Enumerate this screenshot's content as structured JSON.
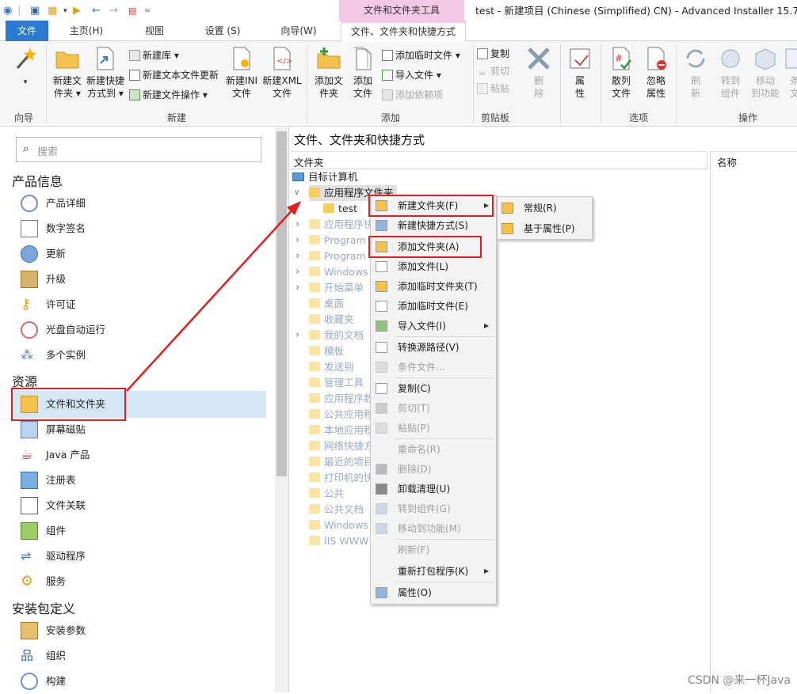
{
  "app": {
    "window_title": "test - 新建项目 (Chinese (Simplified) CN) - Advanced Installer 15.7*",
    "context_tool_tab": "文件和文件夹工具"
  },
  "tabs": [
    {
      "label": "文件"
    },
    {
      "label": "主页(H)"
    },
    {
      "label": "视图"
    },
    {
      "label": "设置 (S)"
    },
    {
      "label": "向导(W)"
    },
    {
      "label": "文件、文件夹和快捷方式"
    }
  ],
  "ribbon": {
    "groups": [
      {
        "label": "向导"
      },
      {
        "label": "新建"
      },
      {
        "label": "添加"
      },
      {
        "label": "剪贴板"
      },
      {
        "label": "选项"
      },
      {
        "label": "操作"
      }
    ],
    "wizard": {
      "label": ""
    },
    "new_folder": [
      "新建文",
      "件夹 ▾"
    ],
    "new_shortcut": [
      "新建快捷",
      "方式到 ▾"
    ],
    "new_lib": "新建库 ▾",
    "new_txt": "新建文本文件更新",
    "new_file_op": "新建文件操作 ▾",
    "new_ini": [
      "新建INI",
      "文件"
    ],
    "new_xml": [
      "新建XML",
      "文件"
    ],
    "add_folder": [
      "添加文",
      "件夹"
    ],
    "add_file": [
      "添加",
      "文件"
    ],
    "add_temp": "添加临时文件 ▾",
    "import_files": "导入文件 ▾",
    "add_dep": "添加依赖项",
    "copy": "复制",
    "cut": "剪切",
    "paste": "粘贴",
    "delete": [
      "删",
      "除"
    ],
    "properties": [
      "属",
      "性"
    ],
    "hash_files": [
      "散列",
      "文件"
    ],
    "ignore_props": [
      "忽略",
      "属性"
    ],
    "refresh": [
      "刷",
      "新"
    ],
    "goto_comp": [
      "转到",
      "组件"
    ],
    "move_feature": [
      "移动",
      "到功能"
    ],
    "cond": [
      "条",
      "文"
    ]
  },
  "left": {
    "search_placeholder": "搜索",
    "sections": [
      {
        "title": "产品信息",
        "items": [
          "产品详细",
          "数字签名",
          "更新",
          "升级",
          "许可证",
          "光盘自动运行",
          "多个实例"
        ]
      },
      {
        "title": "资源",
        "items": [
          "文件和文件夹",
          "屏幕磁贴",
          "Java 产品",
          "注册表",
          "文件关联",
          "组件",
          "驱动程序",
          "服务"
        ]
      },
      {
        "title": "安装包定义",
        "items": [
          "安装参数",
          "组织",
          "构建"
        ]
      }
    ]
  },
  "main": {
    "title": "文件、文件夹和快捷方式",
    "col_folder": "文件夹",
    "col_name": "名称",
    "tree": {
      "root": "目标计算机",
      "app_folder": "应用程序文件夹",
      "child": "test",
      "others": [
        "应用程序快",
        "Program",
        "Program",
        "Windows",
        "开始菜单",
        "桌面",
        "收藏夹",
        "我的文档",
        "模板",
        "发送到",
        "管理工具",
        "应用程序数",
        "公共应用程",
        "本地应用程",
        "网络快捷方",
        "最近的项目",
        "打印机的快",
        "公共",
        "公共文档",
        "Windows",
        "IIS WWW"
      ]
    }
  },
  "context_menu": {
    "items": [
      {
        "label": "新建文件夹(F)",
        "disabled": false,
        "submenu": true
      },
      {
        "label": "新建快捷方式(S)",
        "disabled": false
      },
      {
        "label": "添加文件夹(A)",
        "disabled": false
      },
      {
        "label": "添加文件(L)",
        "disabled": false
      },
      {
        "label": "添加临时文件夹(T)",
        "disabled": false
      },
      {
        "label": "添加临时文件(E)",
        "disabled": false
      },
      {
        "label": "导入文件(I)",
        "disabled": false,
        "submenu": true
      },
      {
        "label": "转换源路径(V)",
        "disabled": false
      },
      {
        "label": "条件文件...",
        "disabled": true
      },
      {
        "label": "复制(C)",
        "disabled": false
      },
      {
        "label": "剪切(T)",
        "disabled": true
      },
      {
        "label": "粘贴(P)",
        "disabled": true
      },
      {
        "label": "重命名(R)",
        "disabled": true
      },
      {
        "label": "删除(D)",
        "disabled": true
      },
      {
        "label": "卸载清理(U)",
        "disabled": false
      },
      {
        "label": "转到组件(G)",
        "disabled": true
      },
      {
        "label": "移动到功能(M)",
        "disabled": true
      },
      {
        "label": "刷新(F)",
        "disabled": true
      },
      {
        "label": "重新打包程序(K)",
        "disabled": false,
        "submenu": true
      },
      {
        "label": "属性(O)",
        "disabled": false
      }
    ],
    "submenu": [
      "常规(R)",
      "基于属性(P)"
    ]
  },
  "watermark": "CSDN @来一杯Java"
}
